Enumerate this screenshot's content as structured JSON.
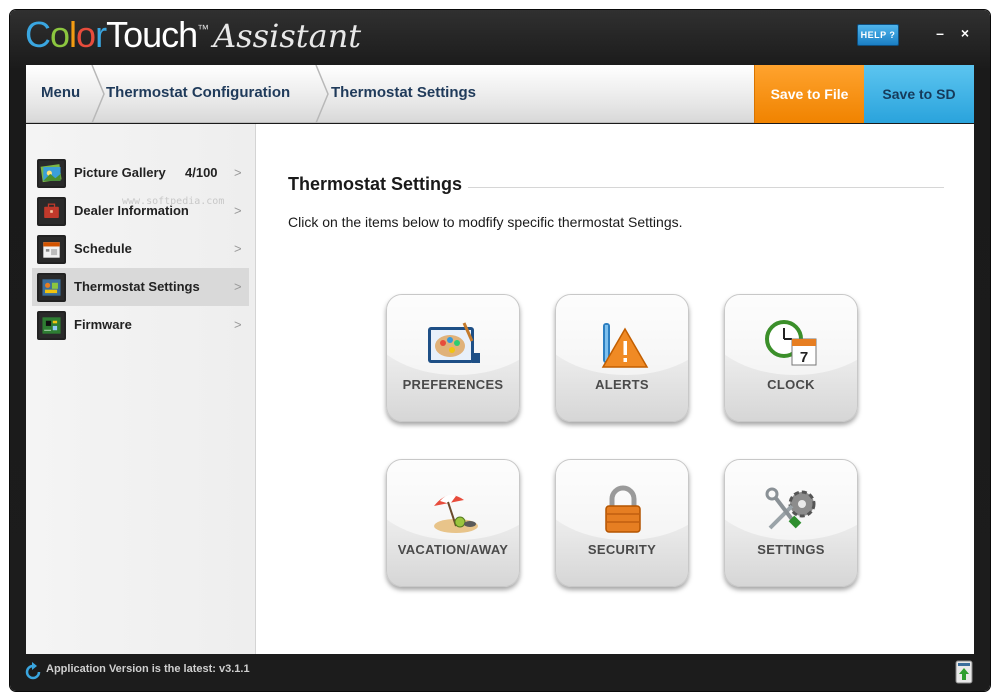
{
  "app": {
    "brand_letters": [
      "C",
      "o",
      "l",
      "o",
      "r"
    ],
    "brand_rest": "Touch",
    "trademark": "™",
    "subtitle": "Assistant",
    "help_label": "HELP ?",
    "minimize_label": "–",
    "close_label": "×"
  },
  "breadcrumb": {
    "items": [
      "Menu",
      "Thermostat Configuration",
      "Thermostat Settings"
    ]
  },
  "actions": {
    "save_file": "Save to File",
    "save_sd": "Save to SD"
  },
  "sidebar": {
    "items": [
      {
        "label": "Picture Gallery",
        "count": "4/100",
        "arrow": ">",
        "icon": "picture-gallery-icon",
        "active": false
      },
      {
        "label": "Dealer Information",
        "count": "",
        "arrow": ">",
        "icon": "dealer-info-icon",
        "active": false
      },
      {
        "label": "Schedule",
        "count": "",
        "arrow": ">",
        "icon": "schedule-icon",
        "active": false
      },
      {
        "label": "Thermostat Settings",
        "count": "",
        "arrow": ">",
        "icon": "thermostat-settings-icon",
        "active": true
      },
      {
        "label": "Firmware",
        "count": "",
        "arrow": ">",
        "icon": "firmware-icon",
        "active": false
      }
    ],
    "watermark": "www.softpedia.com"
  },
  "main": {
    "title": "Thermostat Settings",
    "description": "Click on the items below to modfify specific thermostat Settings.",
    "tiles": [
      {
        "label": "PREFERENCES",
        "icon": "preferences-icon"
      },
      {
        "label": "ALERTS",
        "icon": "alerts-icon"
      },
      {
        "label": "CLOCK",
        "icon": "clock-icon"
      },
      {
        "label": "VACATION/AWAY",
        "icon": "vacation-icon"
      },
      {
        "label": "SECURITY",
        "icon": "padlock-icon"
      },
      {
        "label": "SETTINGS",
        "icon": "tools-icon"
      }
    ]
  },
  "status": {
    "text": "Application Version is the latest: v3.1.1"
  },
  "colors": {
    "accent_orange": "#f08300",
    "accent_blue": "#2aa3dc",
    "brand_blue": "#3aa6e0",
    "brand_green": "#8cc63f",
    "brand_orange": "#f39c12",
    "brand_red": "#e74c3c"
  }
}
